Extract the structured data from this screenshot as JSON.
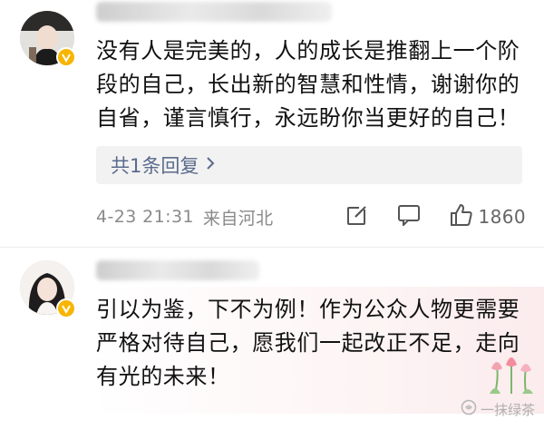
{
  "comments": [
    {
      "text": "没有人是完美的，人的成长是推翻上一个阶段的自己，长出新的智慧和性情，谢谢你的自省，谨言慎行，永远盼你当更好的自己！",
      "replies_label": "共1条回复",
      "time": "4-23 21:31",
      "location": "来自河北",
      "likes": "1860",
      "verified_color": "#f7b500"
    },
    {
      "text": "引以为鉴，下不为例！作为公众人物更需要严格对待自己，愿我们一起改正不足，走向有光的未来！",
      "verified_color": "#f7b500"
    }
  ],
  "icons": {
    "share": "share-icon",
    "comment": "comment-icon",
    "like": "like-icon",
    "chevron": "chevron-right-icon"
  },
  "watermark": {
    "text": "一抹绿茶"
  }
}
